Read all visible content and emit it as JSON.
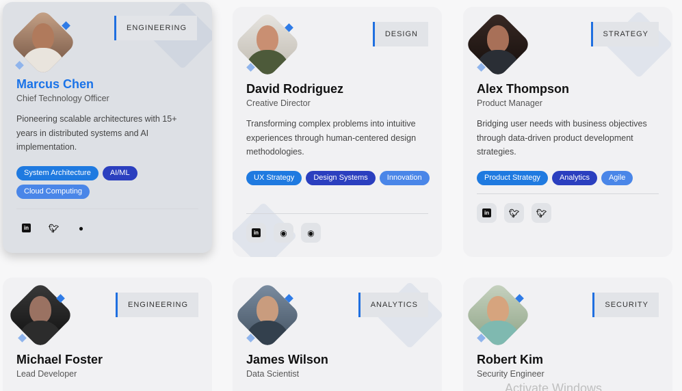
{
  "cards": [
    {
      "tag": "ENGINEERING",
      "name": "Marcus Chen",
      "role": "Chief Technology Officer",
      "bio": "Pioneering scalable architectures with 15+ years in distributed systems and AI implementation.",
      "skills": [
        "System Architecture",
        "AI/ML",
        "Cloud Computing"
      ],
      "socials": [
        "linkedin-icon",
        "twitter-icon",
        "github-icon"
      ]
    },
    {
      "tag": "DESIGN",
      "name": "David Rodriguez",
      "role": "Creative Director",
      "bio": "Transforming complex problems into intuitive experiences through human-centered design methodologies.",
      "skills": [
        "UX Strategy",
        "Design Systems",
        "Innovation"
      ],
      "socials": [
        "linkedin-icon",
        "dribbble-icon",
        "dribbble-icon"
      ]
    },
    {
      "tag": "STRATEGY",
      "name": "Alex Thompson",
      "role": "Product Manager",
      "bio": "Bridging user needs with business objectives through data-driven product development strategies.",
      "skills": [
        "Product Strategy",
        "Analytics",
        "Agile"
      ],
      "socials": [
        "linkedin-icon",
        "twitter-icon",
        "twitter-icon"
      ]
    },
    {
      "tag": "ENGINEERING",
      "name": "Michael Foster",
      "role": "Lead Developer"
    },
    {
      "tag": "ANALYTICS",
      "name": "James Wilson",
      "role": "Data Scientist"
    },
    {
      "tag": "SECURITY",
      "name": "Robert Kim",
      "role": "Security Engineer"
    }
  ],
  "watermark": "Activate Windows",
  "colors": {
    "accent": "#1a73e8",
    "skill_primary": "#1f7ae0",
    "skill_dark": "#2b3fbf",
    "skill_light": "#4a86e8"
  }
}
